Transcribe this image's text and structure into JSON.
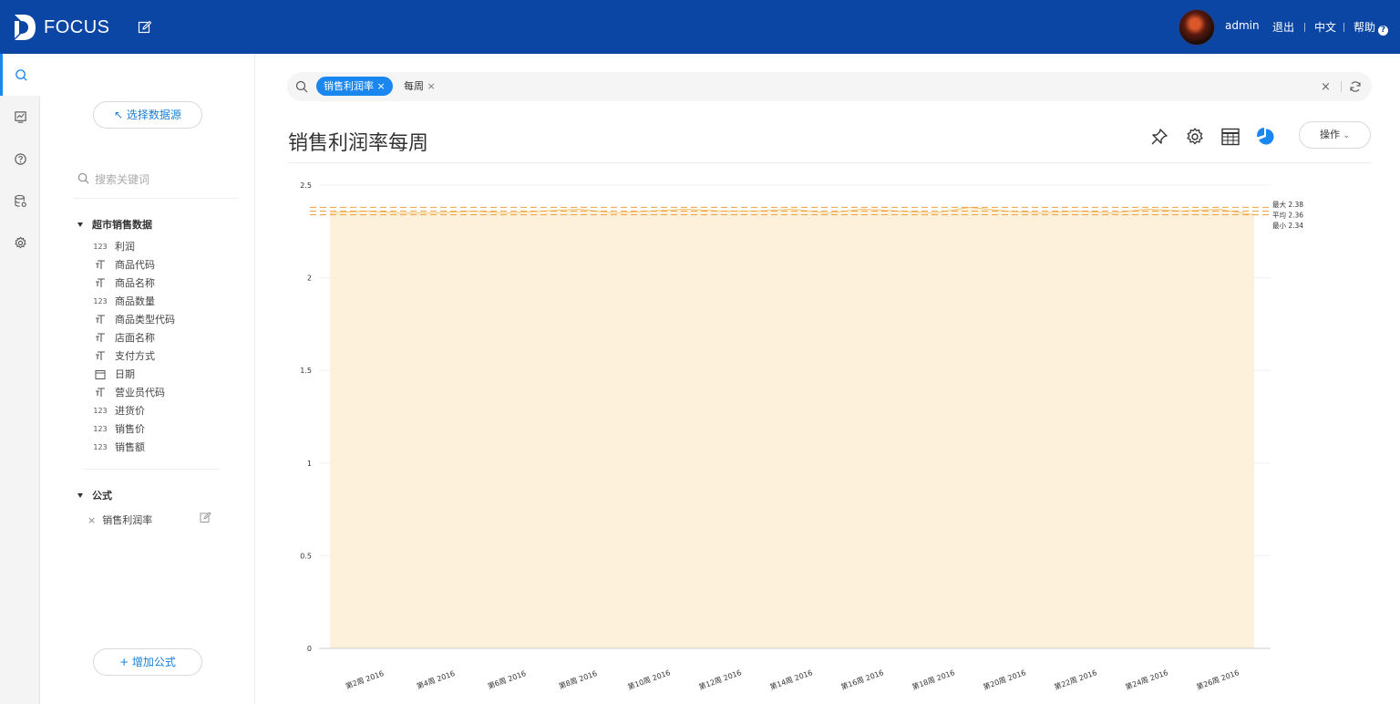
{
  "app": {
    "brand": "FOCUS"
  },
  "header": {
    "user": "admin",
    "logout": "退出",
    "lang": "中文",
    "help": "帮助"
  },
  "rail": [
    {
      "name": "search-icon",
      "active": true
    },
    {
      "name": "dashboard-icon"
    },
    {
      "name": "help-icon"
    },
    {
      "name": "database-icon"
    },
    {
      "name": "settings-icon"
    }
  ],
  "sidebar": {
    "select_source": "↖ 选择数据源",
    "search_placeholder": "搜索关键词",
    "group_name": "超市销售数据",
    "fields": [
      {
        "label": "利润",
        "type": "number"
      },
      {
        "label": "商品代码",
        "type": "text"
      },
      {
        "label": "商品名称",
        "type": "text"
      },
      {
        "label": "商品数量",
        "type": "number"
      },
      {
        "label": "商品类型代码",
        "type": "text"
      },
      {
        "label": "店面名称",
        "type": "text"
      },
      {
        "label": "支付方式",
        "type": "text"
      },
      {
        "label": "日期",
        "type": "date"
      },
      {
        "label": "营业员代码",
        "type": "text"
      },
      {
        "label": "进货价",
        "type": "number"
      },
      {
        "label": "销售价",
        "type": "number"
      },
      {
        "label": "销售额",
        "type": "number"
      }
    ],
    "formula_group": "公式",
    "formula_item": "销售利润率",
    "add_formula": "+ 增加公式"
  },
  "search": {
    "tag_metric": "销售利润率",
    "tag_time": "每周",
    "tag_close": "×",
    "clear": "×"
  },
  "main": {
    "title": "销售利润率每周",
    "ops_label": "操作"
  },
  "chart_data": {
    "type": "area",
    "y_ticks": [
      "0",
      "0.5",
      "1",
      "1.5",
      "2",
      "2.5"
    ],
    "ylim": [
      0,
      2.5
    ],
    "x_tick_labels": [
      "第2周 2016",
      "第4周 2016",
      "第6周 2016",
      "第8周 2016",
      "第10周 2016",
      "第12周 2016",
      "第14周 2016",
      "第16周 2016",
      "第18周 2016",
      "第20周 2016",
      "第22周 2016",
      "第24周 2016",
      "第26周 2016"
    ],
    "series": [
      {
        "values": [
          2.35,
          2.36,
          2.35,
          2.35,
          2.36,
          2.35,
          2.36,
          2.37,
          2.35,
          2.36,
          2.37,
          2.36,
          2.36,
          2.37,
          2.35,
          2.37,
          2.36,
          2.35,
          2.38,
          2.36,
          2.35,
          2.36,
          2.35,
          2.37,
          2.36,
          2.37,
          2.34
        ]
      }
    ],
    "reference_lines": [
      {
        "label": "最大 2.38",
        "value": 2.38
      },
      {
        "label": "平均 2.36",
        "value": 2.36
      },
      {
        "label": "最小 2.34",
        "value": 2.34
      }
    ],
    "colors": {
      "fill": "#fdf1dc",
      "line": "#f5c470",
      "ref": "#f0a040"
    }
  }
}
